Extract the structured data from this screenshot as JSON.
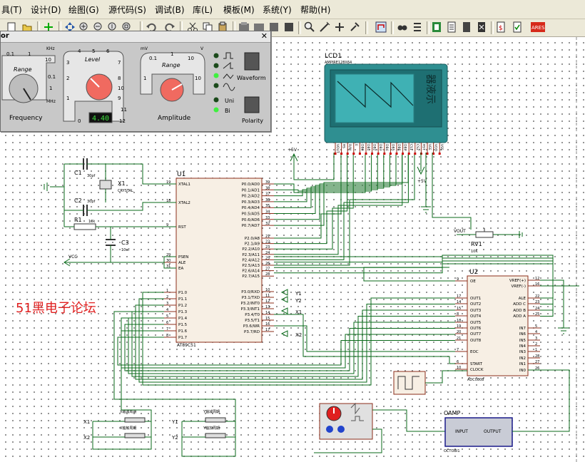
{
  "menu": [
    "具(T)",
    "设计(D)",
    "绘图(G)",
    "源代码(S)",
    "调试(B)",
    "库(L)",
    "模板(M)",
    "系统(Y)",
    "帮助(H)"
  ],
  "toolbar_icons": [
    "new-icon",
    "open-icon",
    "zoom-in-icon",
    "zoom-out-icon",
    "zoom-area-icon",
    "zoom-all-icon",
    "undo-icon",
    "redo-icon",
    "cut-icon",
    "copy-icon",
    "paste-icon",
    "block-copy-icon",
    "block-move-icon",
    "block-rotate-icon",
    "block-delete-icon",
    "pick-device-icon",
    "make-device-icon",
    "packaging-tool-icon",
    "decompose-icon",
    "wire-autorouter-icon",
    "search-tag-icon",
    "property-assignment-icon",
    "design-explorer-icon",
    "new-sheet-icon",
    "remove-sheet-icon",
    "exit-to-parent-icon",
    "bill-of-materials-icon",
    "electrical-rule-check-icon",
    "ares-netlist-icon"
  ],
  "generator": {
    "title": "or",
    "frequency": {
      "range_label": "Range",
      "name": "Frequency",
      "unit_top": "KHz",
      "unit_side": "MHz",
      "scale": [
        "0.1",
        "1",
        "10",
        "0.1",
        "1"
      ]
    },
    "level": {
      "label": "Level",
      "scale": [
        "4",
        "5",
        "6",
        "3",
        "7",
        "2",
        "8",
        "1",
        "9",
        "0",
        "10",
        "11",
        "12"
      ],
      "display": "4.40"
    },
    "amplitude": {
      "range_label": "Range",
      "name": "Amplitude",
      "unit_left": "mV",
      "unit_right": "V",
      "scale": [
        "0.1",
        "1",
        "10",
        "1",
        "10"
      ]
    },
    "waveform_label": "Waveform",
    "uni_label": "Uni",
    "bi_label": "Bi",
    "polarity_label": "Polarity"
  },
  "lcd": {
    "ref": "LCD1",
    "part": "AMPIRE128X64",
    "side_text": "器液示",
    "pins": [
      "VOUT",
      "RS",
      "R/W",
      "E",
      "DB0",
      "DB1",
      "DB2",
      "DB3",
      "DB4",
      "DB5",
      "DB6",
      "DB7",
      "CS1",
      "CS2",
      "RST",
      "VEE",
      "VDD",
      "VSS"
    ]
  },
  "mcu": {
    "ref": "U1",
    "part": "AT89C51",
    "left_pins": [
      "XTAL1",
      "XTAL2",
      "RST",
      "PSEN",
      "ALE",
      "EA",
      "P1.0",
      "P1.1",
      "P1.2",
      "P1.3",
      "P1.4",
      "P1.5",
      "P1.6",
      "P1.7"
    ],
    "left_nums": [
      "19",
      "18",
      "9",
      "29",
      "30",
      "31",
      "1",
      "2",
      "3",
      "4",
      "5",
      "6",
      "7",
      "8"
    ],
    "right_pins": [
      "P0.0/AD0",
      "P0.1/AD1",
      "P0.2/AD2",
      "P0.3/AD3",
      "P0.4/AD4",
      "P0.5/AD5",
      "P0.6/AD6",
      "P0.7/AD7",
      "P2.0/A8",
      "P2.1/A9",
      "P2.2/A10",
      "P2.3/A11",
      "P2.4/A12",
      "P2.5/A13",
      "P2.6/A14",
      "P2.7/A15",
      "P3.0/RXD",
      "P3.1/TXD",
      "P3.2/INT0",
      "P3.3/INT1",
      "P3.4/T0",
      "P3.5/T1",
      "P3.6/WR",
      "P3.7/RD"
    ],
    "right_nums": [
      "39",
      "38",
      "37",
      "36",
      "35",
      "34",
      "33",
      "32",
      "21",
      "22",
      "23",
      "24",
      "25",
      "26",
      "27",
      "28",
      "10",
      "11",
      "12",
      "13",
      "14",
      "15",
      "16",
      "17"
    ]
  },
  "adc": {
    "ref": "U2",
    "part": "ADC0808",
    "left_pins": [
      "OE",
      "OUT1",
      "OUT2",
      "OUT3",
      "OUT4",
      "OUT5",
      "OUT6",
      "OUT7",
      "OUT8",
      "EOC",
      "START",
      "CLOCK"
    ],
    "left_nums": [
      "9",
      "17",
      "14",
      "15",
      "8",
      "18",
      "19",
      "20",
      "21",
      "7",
      "6",
      "10"
    ],
    "right_pins": [
      "VREF(+)",
      "VREF(-)",
      "ALE",
      "ADD C",
      "ADD B",
      "ADD A",
      "IN7",
      "IN6",
      "IN5",
      "IN4",
      "IN3",
      "IN2",
      "IN1",
      "IN0"
    ],
    "right_nums": [
      "12",
      "16",
      "22",
      "23",
      "24",
      "25",
      "5",
      "4",
      "3",
      "2",
      "1",
      "28",
      "27",
      "26"
    ]
  },
  "components": {
    "c1": "C1",
    "c1_val": "30pf",
    "c2": "C2",
    "c2_val": "30pf",
    "x1": "X1",
    "x1_val": "CRYSTAL",
    "r1": "R1",
    "r1_val": "10k",
    "c3": "C3",
    "c3_val": "10uf",
    "rv1": "RV1",
    "rv1_val": "10K",
    "vcc": "VCC",
    "vout": "VOUT",
    "plus5v_a": "+5V",
    "plus5v_b": "+5V",
    "y1": "Y1",
    "y2": "Y2",
    "x1_label": "X1",
    "x2_label": "X2"
  },
  "buttons": {
    "x_up": "X1",
    "x_dn": "X2",
    "y_up": "Y1",
    "y_dn": "Y2",
    "x_cap1": "X轴减周期",
    "x_cap2": "X轴加周期",
    "y_cap1": "Y轴减周期",
    "y_cap2": "Y轴加周期"
  },
  "opamp": {
    "ref": "OAMP",
    "part": "OCTOBI1",
    "in": "INPUT",
    "out": "OUTPUT"
  },
  "watermark": "51黑电子论坛"
}
